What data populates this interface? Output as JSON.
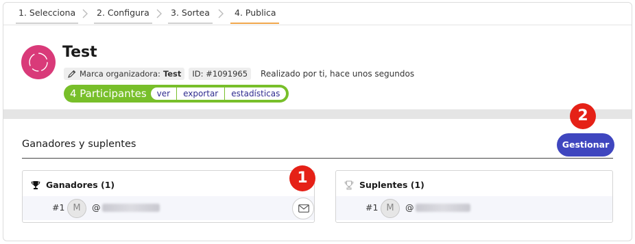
{
  "steps": [
    {
      "label": "1. Selecciona"
    },
    {
      "label": "2. Configura"
    },
    {
      "label": "3. Sortea"
    },
    {
      "label": "4. Publica"
    }
  ],
  "header": {
    "title": "Test",
    "brand_label": "Marca organizadora:",
    "brand_name": "Test",
    "id": "ID: #1091965",
    "performed": "Realizado por ti, hace unos segundos"
  },
  "participants": {
    "count": "4 Participantes",
    "view": "ver",
    "export": "exportar",
    "stats": "estadísticas"
  },
  "section": {
    "title": "Ganadores y suplentes",
    "manage_label": "Gestionar"
  },
  "badges": {
    "one": "1",
    "two": "2"
  },
  "winners": {
    "title": "Ganadores (1)",
    "rows": [
      {
        "rank": "#1",
        "avatar": "M",
        "handle_prefix": "@"
      }
    ]
  },
  "substitutes": {
    "title": "Suplentes (1)",
    "rows": [
      {
        "rank": "#1",
        "avatar": "M",
        "handle_prefix": "@"
      }
    ]
  },
  "colors": {
    "active_step": "#f0a64a",
    "logo": "#d93a79",
    "participants": "#78bf2a",
    "manage_button": "#3f46bf",
    "badge": "#e52117"
  },
  "icons": {
    "pencil": "pencil-icon",
    "trophy_filled": "trophy-icon",
    "trophy_outline": "trophy-outline-icon",
    "mail": "mail-icon",
    "chevron": "chevron-right-icon"
  }
}
